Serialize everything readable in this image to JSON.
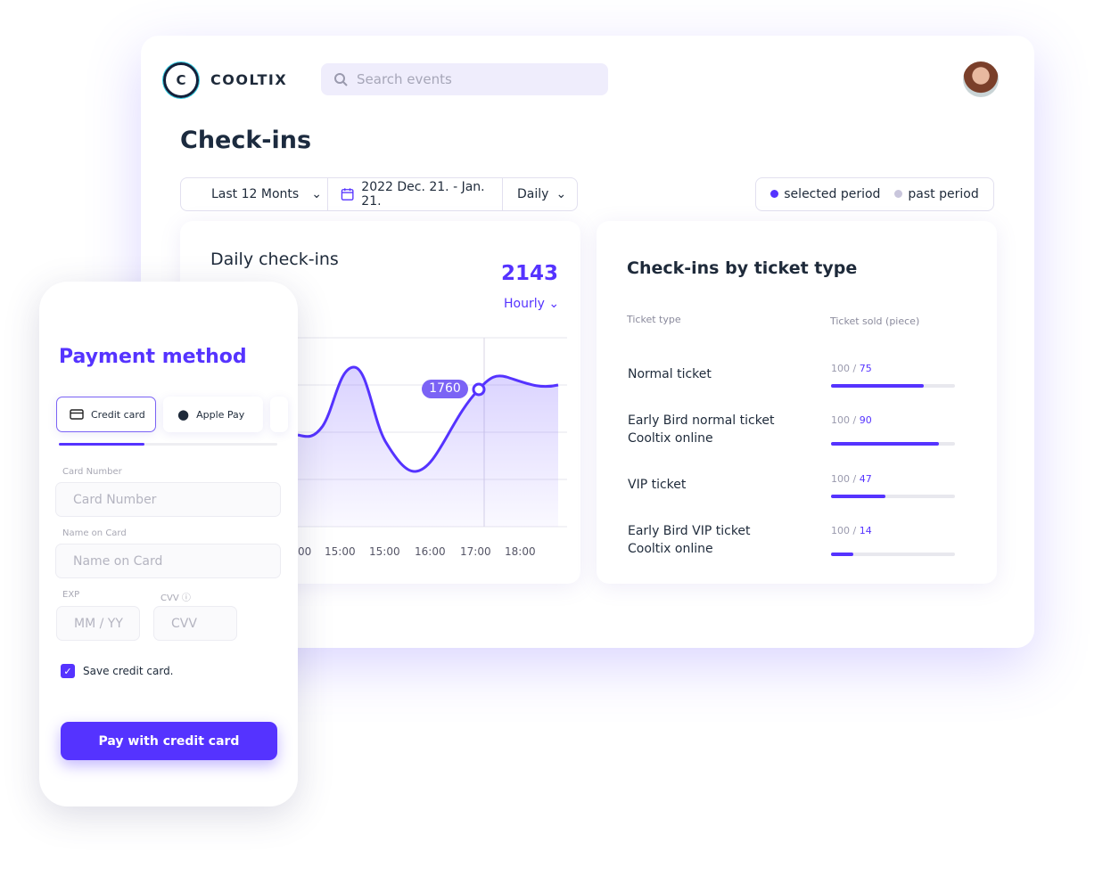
{
  "brand": {
    "logo_letter": "C",
    "name": "COOLTIX"
  },
  "search": {
    "placeholder": "Search events"
  },
  "page_title": "Check-ins",
  "filters": {
    "range": "Last 12 Monts",
    "dates": "2022 Dec. 21. - Jan. 21.",
    "granularity": "Daily"
  },
  "legend": {
    "selected": "selected period",
    "past": "past period",
    "selected_color": "#5533ff",
    "past_color": "#c9c6dc"
  },
  "daily": {
    "title": "Daily check-ins",
    "total": "2143",
    "interval": "Hourly",
    "tooltip": "1760",
    "ticks": [
      "00",
      "15:00",
      "15:00",
      "16:00",
      "17:00",
      "18:00"
    ]
  },
  "tickets": {
    "title": "Check-ins by ticket type",
    "col1": "Ticket type",
    "col2": "Ticket sold (piece)",
    "rows": [
      {
        "name": "Normal ticket",
        "sub": "",
        "total": "100",
        "sold": "75",
        "pct": 75
      },
      {
        "name": "Early Bird normal ticket",
        "sub": "Cooltix online",
        "total": "100",
        "sold": "90",
        "pct": 87
      },
      {
        "name": "VIP ticket",
        "sub": "",
        "total": "100",
        "sold": "47",
        "pct": 44
      },
      {
        "name": "Early Bird VIP ticket",
        "sub": "Cooltix online",
        "total": "100",
        "sold": "14",
        "pct": 18
      }
    ]
  },
  "payment": {
    "title": "Payment method",
    "tabs": [
      "Credit card",
      "Apple Pay"
    ],
    "card_label": "Card Number",
    "card_placeholder": "Card Number",
    "name_label": "Name on Card",
    "name_placeholder": "Name on Card",
    "exp_label": "EXP",
    "exp_placeholder": "MM / YY",
    "cvv_label": "CVV",
    "cvv_placeholder": "CVV",
    "save_label": "Save credit card.",
    "save_checked": true,
    "pay_label": "Pay with credit card"
  },
  "accent": "#5533ff"
}
